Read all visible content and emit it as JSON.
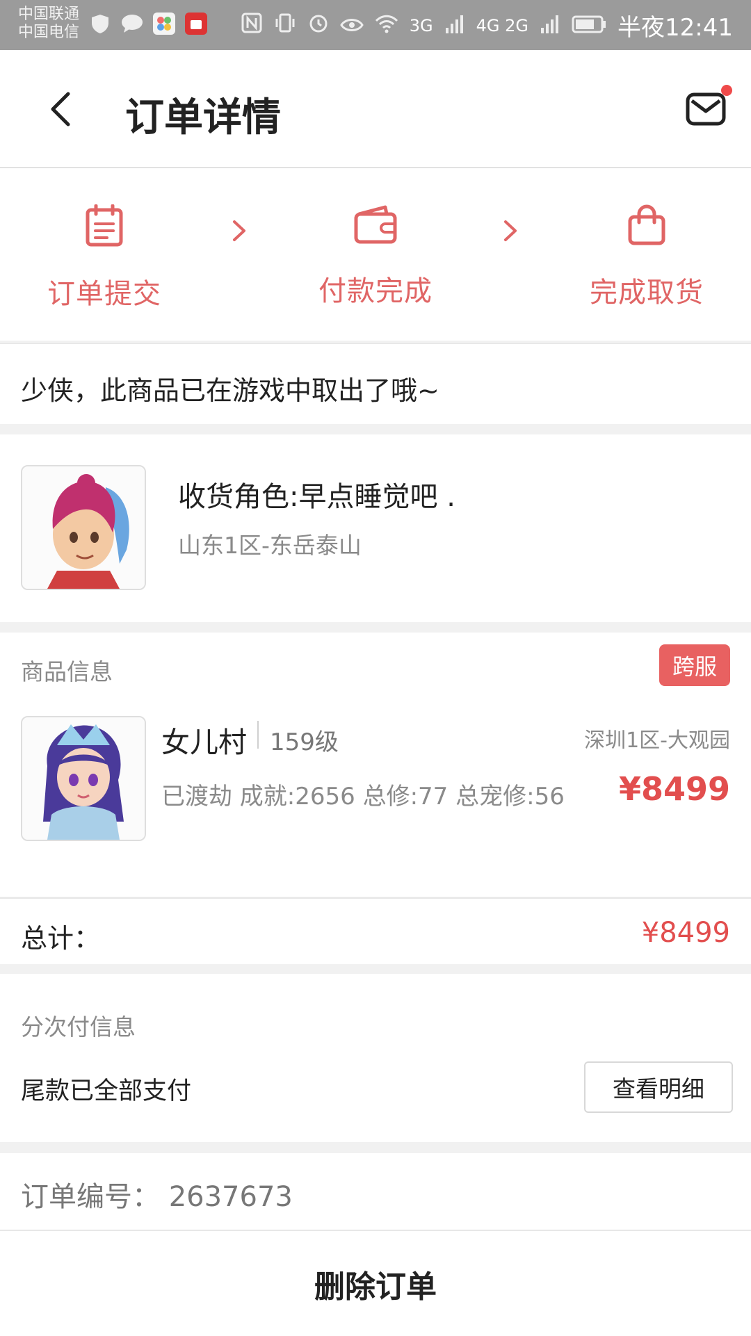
{
  "status_bar": {
    "carrier_1": "中国联通",
    "carrier_2": "中国电信",
    "network_1": "3G",
    "network_2": "4G 2G",
    "time": "半夜12:41"
  },
  "header": {
    "title": "订单详情",
    "back_icon": "chevron-left-icon",
    "message_icon": "envelope-icon",
    "has_unread_dot": true
  },
  "steps": [
    {
      "label": "订单提交",
      "icon": "clipboard-icon"
    },
    {
      "label": "付款完成",
      "icon": "wallet-icon"
    },
    {
      "label": "完成取货",
      "icon": "shopping-bag-icon"
    }
  ],
  "notice": "少侠，此商品已在游戏中取出了哦~",
  "receiver": {
    "role": "收货角色:早点睡觉吧 .",
    "server": "山东1区-东岳泰山"
  },
  "product_section": {
    "label": "商品信息",
    "badge": "跨服",
    "item": {
      "name": "女儿村",
      "level": "159级",
      "server": "深圳1区-大观园",
      "stats": "已渡劫 成就:2656 总修:77 总宠修:56",
      "price": "¥8499"
    }
  },
  "total": {
    "label": "总计：",
    "value": "¥8499"
  },
  "installment": {
    "label": "分次付信息",
    "status": "尾款已全部支付",
    "detail_button": "查看明细"
  },
  "order_number": "订单编号：  2637673",
  "delete_button": "删除订单",
  "colors": {
    "accent": "#e06565",
    "price": "#e24e4e",
    "badge": "#e86161"
  }
}
